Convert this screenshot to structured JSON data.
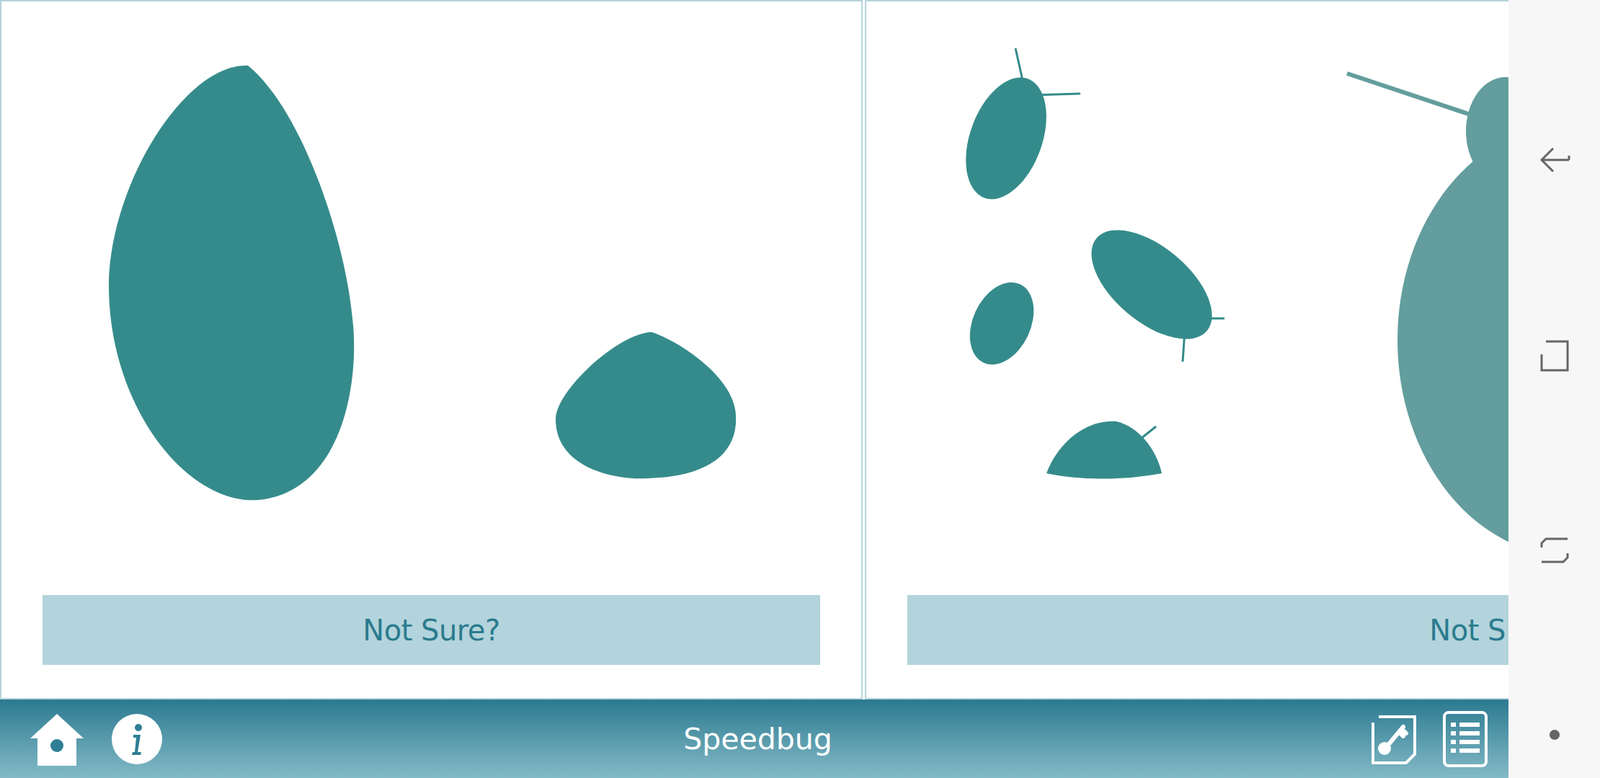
{
  "app": {
    "title": "Speedbug"
  },
  "cards": [
    {
      "button": "Not Sure?",
      "figure": "pair"
    },
    {
      "button": "Not S",
      "figure": "group"
    }
  ]
}
